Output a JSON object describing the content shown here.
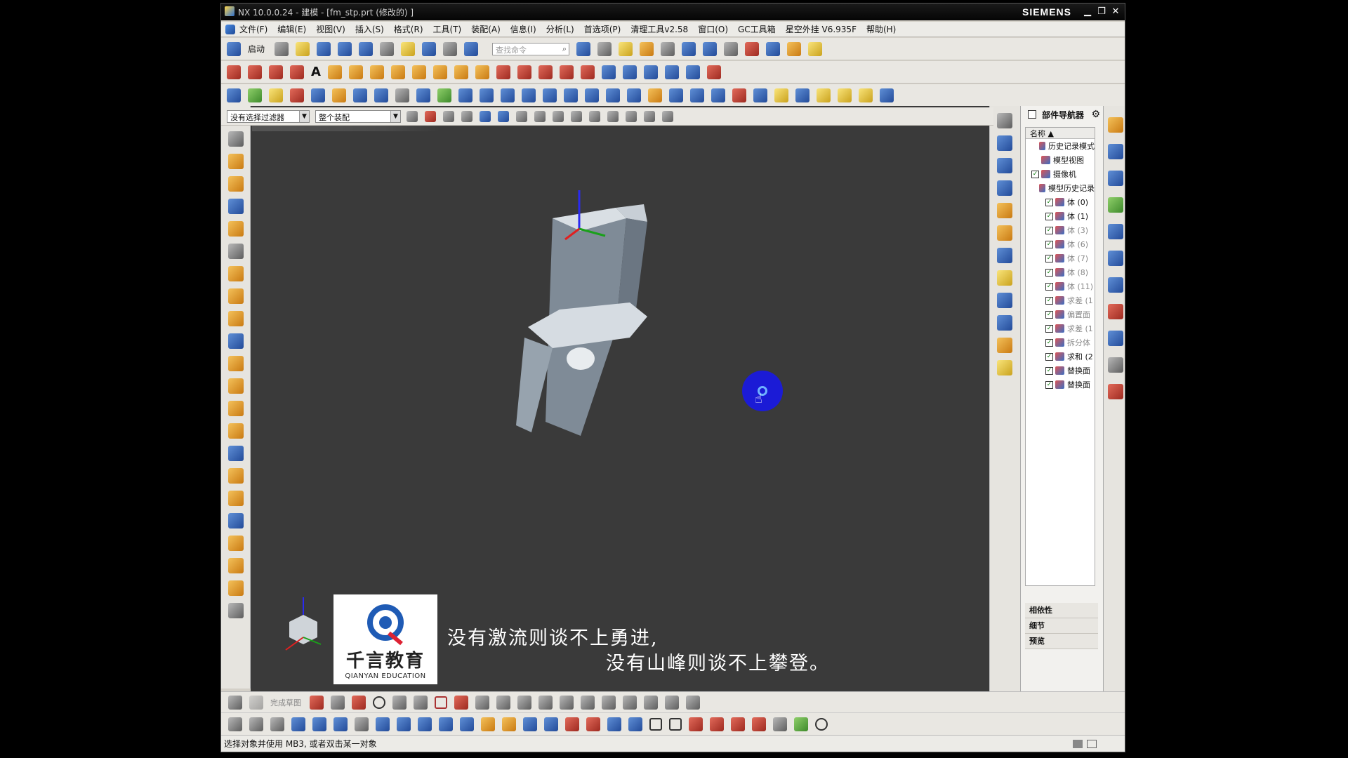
{
  "app": {
    "title": "NX 10.0.0.24 - 建模 - [fm_stp.prt  (修改的) ]",
    "brand": "SIEMENS",
    "window_buttons": [
      "minimize-icon",
      "restore-icon",
      "close-icon"
    ]
  },
  "menubar": {
    "items": [
      "文件(F)",
      "编辑(E)",
      "视图(V)",
      "插入(S)",
      "格式(R)",
      "工具(T)",
      "装配(A)",
      "信息(I)",
      "分析(L)",
      "首选项(P)",
      "清理工具v2.58",
      "窗口(O)",
      "GC工具箱",
      "星空外挂 V6.935F",
      "帮助(H)"
    ]
  },
  "toolbar": {
    "start_label": "启动",
    "search_placeholder": "查找命令"
  },
  "filterbar": {
    "selection_filter": "没有选择过滤器",
    "assembly_scope": "整个装配"
  },
  "part_navigator": {
    "title": "部件导航器",
    "column_name": "名称",
    "nodes": [
      {
        "label": "历史记录模式",
        "checked": false,
        "grey": false
      },
      {
        "label": "模型视图",
        "checked": false,
        "grey": false
      },
      {
        "label": "摄像机",
        "checked": true,
        "grey": false
      },
      {
        "label": "模型历史记录",
        "checked": false,
        "grey": false
      },
      {
        "label": "体 (0)",
        "checked": true,
        "grey": false
      },
      {
        "label": "体 (1)",
        "checked": true,
        "grey": false
      },
      {
        "label": "体 (3)",
        "checked": true,
        "grey": true
      },
      {
        "label": "体 (6)",
        "checked": true,
        "grey": true
      },
      {
        "label": "体 (7)",
        "checked": true,
        "grey": true
      },
      {
        "label": "体 (8)",
        "checked": true,
        "grey": true
      },
      {
        "label": "体 (11)",
        "checked": true,
        "grey": true
      },
      {
        "label": "求差 (1",
        "checked": true,
        "grey": true
      },
      {
        "label": "偏置面",
        "checked": true,
        "grey": true
      },
      {
        "label": "求差 (1",
        "checked": true,
        "grey": true
      },
      {
        "label": "拆分体",
        "checked": true,
        "grey": true
      },
      {
        "label": "求和 (2",
        "checked": true,
        "grey": false
      },
      {
        "label": "替换面",
        "checked": true,
        "grey": false
      },
      {
        "label": "替换面",
        "checked": true,
        "grey": false
      }
    ],
    "panels": [
      "相依性",
      "细节",
      "预览"
    ]
  },
  "viewport": {
    "logo_cn": "千言教育",
    "logo_en": "QIANYAN EDUCATION",
    "caption_line1": "没有激流则谈不上勇进,",
    "caption_line2": "没有山峰则谈不上攀登。"
  },
  "bottom_toolbar": {
    "sketch_label": "完成草图"
  },
  "statusbar": {
    "message": "选择对象并使用 MB3, 或者双击某一对象"
  },
  "colors": {
    "viewport_bg": "#3a3a3a",
    "model_fill": "#8e9aa6",
    "cursor_highlight": "#1b1bd6"
  }
}
